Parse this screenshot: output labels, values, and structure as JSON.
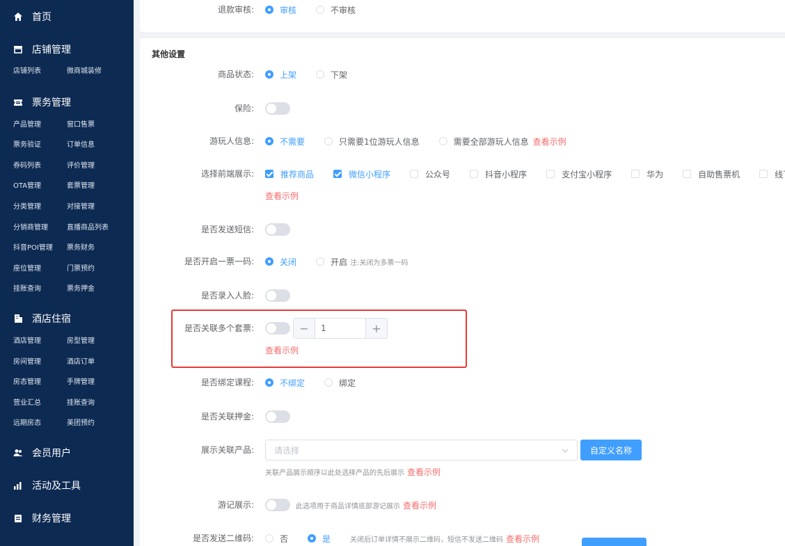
{
  "sidebar": {
    "sections": [
      {
        "label": "首页",
        "icon": "home-icon"
      },
      {
        "label": "店铺管理",
        "icon": "store-icon",
        "items": [
          "店铺列表",
          "微商城装修"
        ]
      },
      {
        "label": "票务管理",
        "icon": "ticket-icon",
        "items": [
          "产品管理",
          "窗口售票",
          "票务验证",
          "订单信息",
          "券码列表",
          "评价管理",
          "OTA管理",
          "套票管理",
          "分类管理",
          "对接管理",
          "分销商管理",
          "直播商品列表",
          "抖音POI管理",
          "票务财务",
          "座位管理",
          "门票预约",
          "挂账查询",
          "票务押金"
        ]
      },
      {
        "label": "酒店住宿",
        "icon": "hotel-icon",
        "items": [
          "酒店管理",
          "房型管理",
          "房间管理",
          "酒店订单",
          "房态管理",
          "手牌管理",
          "营业汇总",
          "挂账查询",
          "远期房态",
          "美团预约"
        ]
      },
      {
        "label": "会员用户",
        "icon": "users-icon"
      },
      {
        "label": "活动及工具",
        "icon": "chart-icon"
      },
      {
        "label": "财务管理",
        "icon": "finance-icon"
      }
    ]
  },
  "form": {
    "refund_review": {
      "label": "退款审核:",
      "options": [
        "审核",
        "不审核"
      ]
    },
    "other_settings_title": "其他设置",
    "product_status": {
      "label": "商品状态:",
      "options": [
        "上架",
        "下架"
      ]
    },
    "insurance": {
      "label": "保险:"
    },
    "visitor_info": {
      "label": "游玩人信息:",
      "options": [
        "不需要",
        "只需要1位游玩人信息",
        "需要全部游玩人信息"
      ],
      "example": "查看示例"
    },
    "frontend_display": {
      "label": "选择前端展示:",
      "options": [
        "推荐商品",
        "微信小程序",
        "公众号",
        "抖音小程序",
        "支付宝小程序",
        "华为",
        "自助售票机",
        "线下购"
      ],
      "example": "查看示例"
    },
    "send_sms": {
      "label": "是否发送短信:"
    },
    "one_ticket_one_code": {
      "label": "是否开启一票一码:",
      "options": [
        "关闭",
        "开启"
      ],
      "note": "注:关闭为多票一码"
    },
    "face_record": {
      "label": "是否录入人脸:"
    },
    "multi_package": {
      "label": "是否关联多个套票:",
      "stepper_value": "1",
      "minus": "−",
      "plus": "+",
      "example": "查看示例"
    },
    "bind_course": {
      "label": "是否绑定课程:",
      "options": [
        "不绑定",
        "绑定"
      ]
    },
    "deposit": {
      "label": "是否关联押金:"
    },
    "related_products": {
      "label": "展示关联产品:",
      "placeholder": "请选择",
      "button": "自定义名称",
      "hint": "关联产品展示顺序以此处选择产品的先后展示",
      "example": "查看示例"
    },
    "travel_notes": {
      "label": "游记展示:",
      "hint": "此选项用于商品详情底部游记展示",
      "example": "查看示例"
    },
    "send_qrcode": {
      "label": "是否发送二维码:",
      "options": [
        "否",
        "是"
      ],
      "hint": "关闭后订单详情不展示二维码，短信不发送二维码",
      "example": "查看示例"
    }
  }
}
